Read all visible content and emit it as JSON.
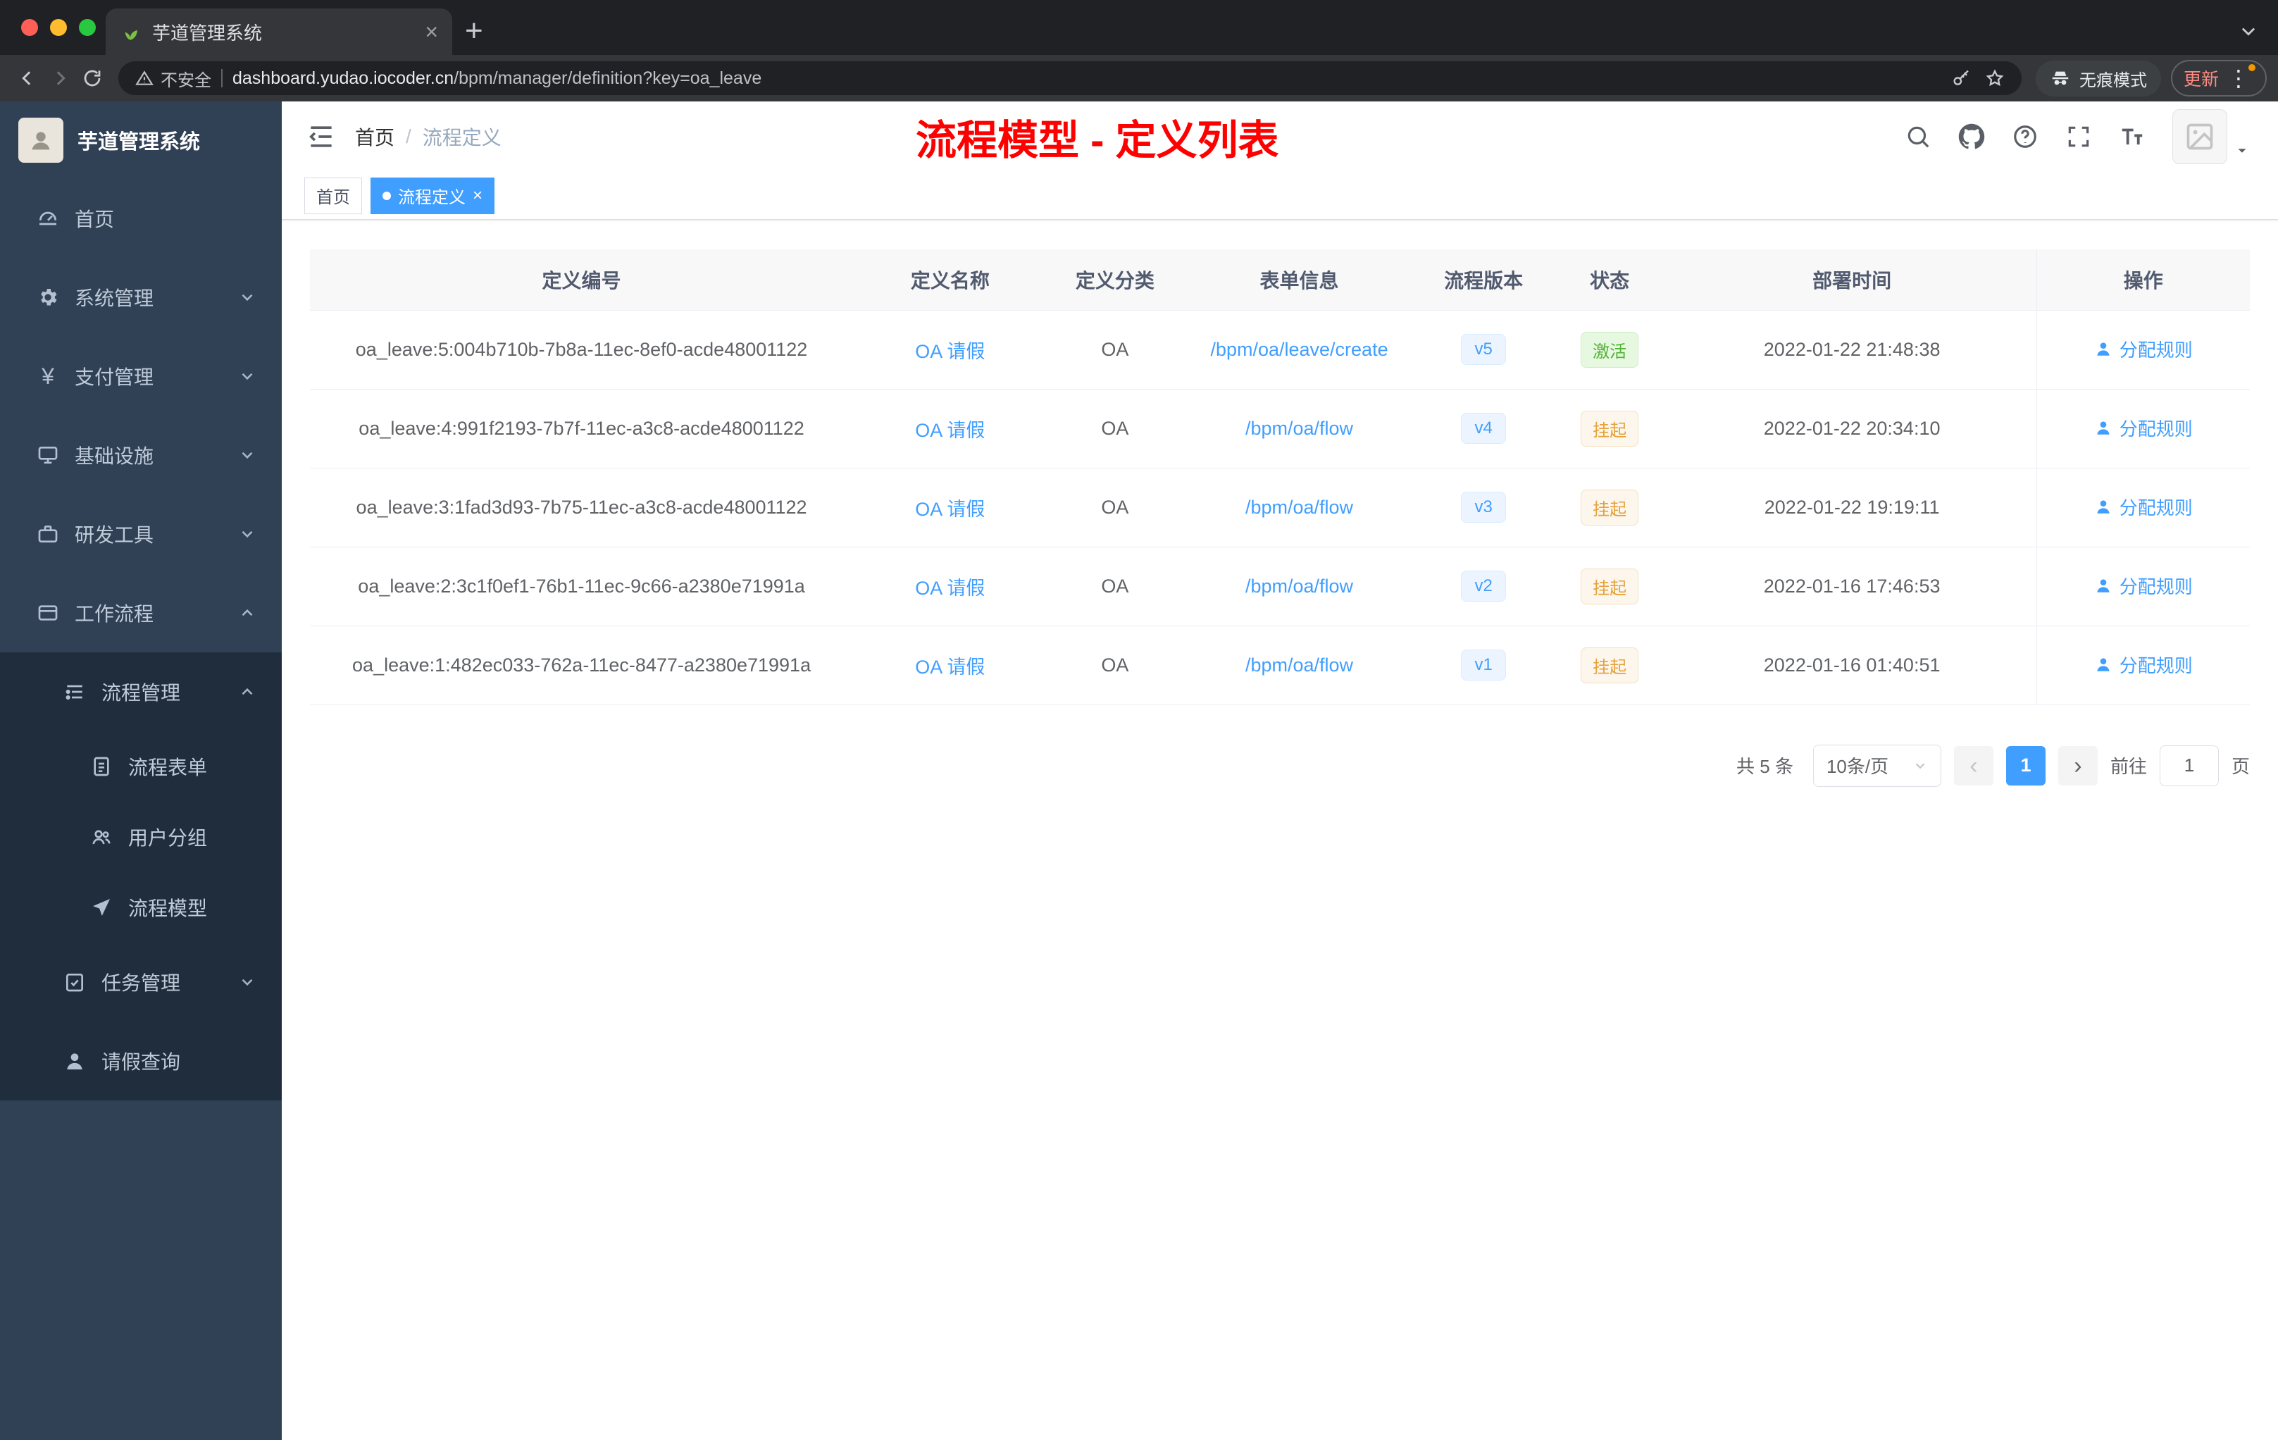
{
  "browser": {
    "tab_title": "芋道管理系统",
    "security_label": "不安全",
    "url_host": "dashboard.yudao.iocoder.cn",
    "url_path": "/bpm/manager/definition?key=oa_leave",
    "incognito_label": "无痕模式",
    "update_label": "更新"
  },
  "sidebar": {
    "logo_title": "芋道管理系统",
    "items": [
      {
        "label": "首页"
      },
      {
        "label": "系统管理"
      },
      {
        "label": "支付管理"
      },
      {
        "label": "基础设施"
      },
      {
        "label": "研发工具"
      },
      {
        "label": "工作流程"
      },
      {
        "label": "流程管理"
      },
      {
        "label": "流程表单"
      },
      {
        "label": "用户分组"
      },
      {
        "label": "流程模型"
      },
      {
        "label": "任务管理"
      },
      {
        "label": "请假查询"
      }
    ]
  },
  "header": {
    "breadcrumb_home": "首页",
    "breadcrumb_sep": "/",
    "breadcrumb_current": "流程定义",
    "annotation": "流程模型 - 定义列表"
  },
  "tags": [
    {
      "label": "首页",
      "active": false
    },
    {
      "label": "流程定义",
      "active": true
    }
  ],
  "table": {
    "columns": [
      "定义编号",
      "定义名称",
      "定义分类",
      "表单信息",
      "流程版本",
      "状态",
      "部署时间",
      "操作"
    ],
    "rows": [
      {
        "id": "oa_leave:5:004b710b-7b8a-11ec-8ef0-acde48001122",
        "name": "OA 请假",
        "category": "OA",
        "form": "/bpm/oa/leave/create",
        "version": "v5",
        "status": "激活",
        "status_type": "success",
        "time": "2022-01-22 21:48:38",
        "action": "分配规则"
      },
      {
        "id": "oa_leave:4:991f2193-7b7f-11ec-a3c8-acde48001122",
        "name": "OA 请假",
        "category": "OA",
        "form": "/bpm/oa/flow",
        "version": "v4",
        "status": "挂起",
        "status_type": "warning",
        "time": "2022-01-22 20:34:10",
        "action": "分配规则"
      },
      {
        "id": "oa_leave:3:1fad3d93-7b75-11ec-a3c8-acde48001122",
        "name": "OA 请假",
        "category": "OA",
        "form": "/bpm/oa/flow",
        "version": "v3",
        "status": "挂起",
        "status_type": "warning",
        "time": "2022-01-22 19:19:11",
        "action": "分配规则"
      },
      {
        "id": "oa_leave:2:3c1f0ef1-76b1-11ec-9c66-a2380e71991a",
        "name": "OA 请假",
        "category": "OA",
        "form": "/bpm/oa/flow",
        "version": "v2",
        "status": "挂起",
        "status_type": "warning",
        "time": "2022-01-16 17:46:53",
        "action": "分配规则"
      },
      {
        "id": "oa_leave:1:482ec033-762a-11ec-8477-a2380e71991a",
        "name": "OA 请假",
        "category": "OA",
        "form": "/bpm/oa/flow",
        "version": "v1",
        "status": "挂起",
        "status_type": "warning",
        "time": "2022-01-16 01:40:51",
        "action": "分配规则"
      }
    ]
  },
  "pagination": {
    "total": "共 5 条",
    "page_size": "10条/页",
    "current_page": "1",
    "goto_label": "前往",
    "goto_value": "1",
    "page_unit": "页"
  },
  "colors": {
    "accent": "#409eff",
    "success": "#4fb233",
    "warning": "#e6a23c",
    "annotation": "#fe0000",
    "sidebar_bg": "#304156",
    "submenu_bg": "#1f2d3d"
  }
}
